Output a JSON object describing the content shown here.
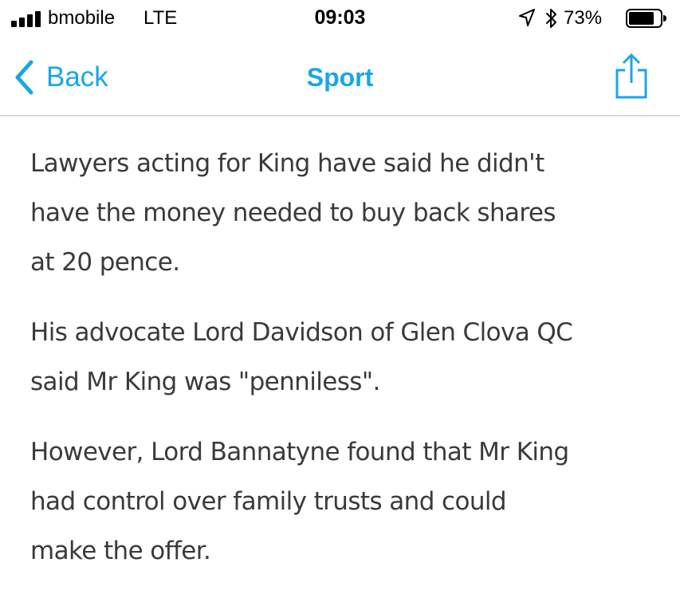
{
  "status_bar": {
    "carrier": "bmobile",
    "network": "LTE",
    "time": "09:03",
    "battery_percent": "73%",
    "icons": [
      "signal-icon",
      "location-icon",
      "bluetooth-icon",
      "battery-icon"
    ]
  },
  "nav": {
    "back_label": "Back",
    "title": "Sport",
    "accent_color": "#1aa6e6",
    "share_icon": "share-icon"
  },
  "article": {
    "paragraphs": [
      {
        "lines": [
          "Lawyers acting for King have said he didn't",
          "have the money needed to buy back shares",
          "at 20 pence."
        ]
      },
      {
        "lines": [
          "His advocate Lord Davidson of Glen Clova QC",
          "said Mr King was \"penniless\"."
        ]
      },
      {
        "lines": [
          "However, Lord Bannatyne found that Mr King",
          "had control over family trusts and could",
          "make the offer."
        ]
      }
    ]
  }
}
